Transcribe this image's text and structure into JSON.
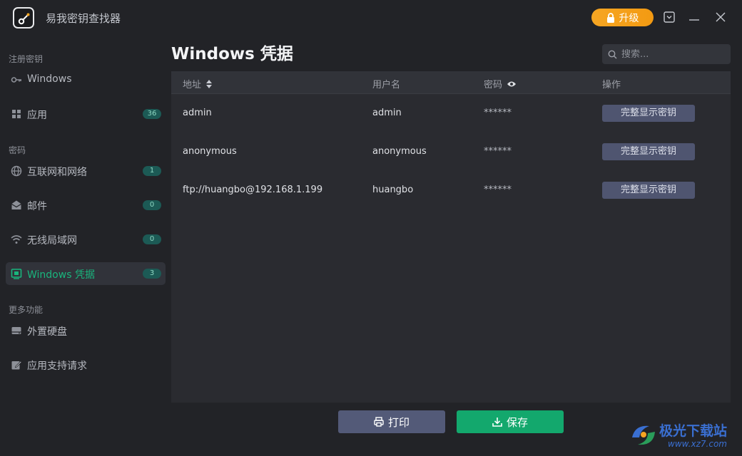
{
  "app": {
    "title": "易我密钥查找器",
    "upgrade_label": "升级"
  },
  "sidebar": {
    "sections": [
      {
        "label": "注册密钥"
      },
      {
        "label": "密码"
      },
      {
        "label": "更多功能"
      }
    ],
    "items": [
      {
        "label": "Windows",
        "icon": "key-icon",
        "badge": ""
      },
      {
        "label": "应用",
        "icon": "apps-grid-icon",
        "badge": "36"
      },
      {
        "label": "互联网和网络",
        "icon": "globe-icon",
        "badge": "1"
      },
      {
        "label": "邮件",
        "icon": "mail-icon",
        "badge": "0"
      },
      {
        "label": "无线局域网",
        "icon": "wifi-icon",
        "badge": "0"
      },
      {
        "label": "Windows 凭据",
        "icon": "credential-icon",
        "badge": "3",
        "active": true
      },
      {
        "label": "外置硬盘",
        "icon": "hard-drive-icon",
        "badge": ""
      },
      {
        "label": "应用支持请求",
        "icon": "edit-request-icon",
        "badge": ""
      }
    ]
  },
  "main": {
    "title": "Windows 凭据",
    "search_placeholder": "搜索...",
    "columns": {
      "address": "地址",
      "username": "用户名",
      "password": "密码",
      "action": "操作"
    },
    "rows": [
      {
        "address": "admin",
        "username": "admin",
        "password": "******",
        "action": "完整显示密钥"
      },
      {
        "address": "anonymous",
        "username": "anonymous",
        "password": "******",
        "action": "完整显示密钥"
      },
      {
        "address": "ftp://huangbo@192.168.1.199",
        "username": "huangbo",
        "password": "******",
        "action": "完整显示密钥"
      }
    ],
    "print_label": "打印",
    "save_label": "保存"
  },
  "watermark": {
    "text": "极光下载站",
    "url": "www.xz7.com"
  },
  "colors": {
    "accent_green": "#19b57d",
    "save_green": "#13a86d",
    "upgrade_orange": "#f6a623",
    "button_slate": "#535a78"
  }
}
